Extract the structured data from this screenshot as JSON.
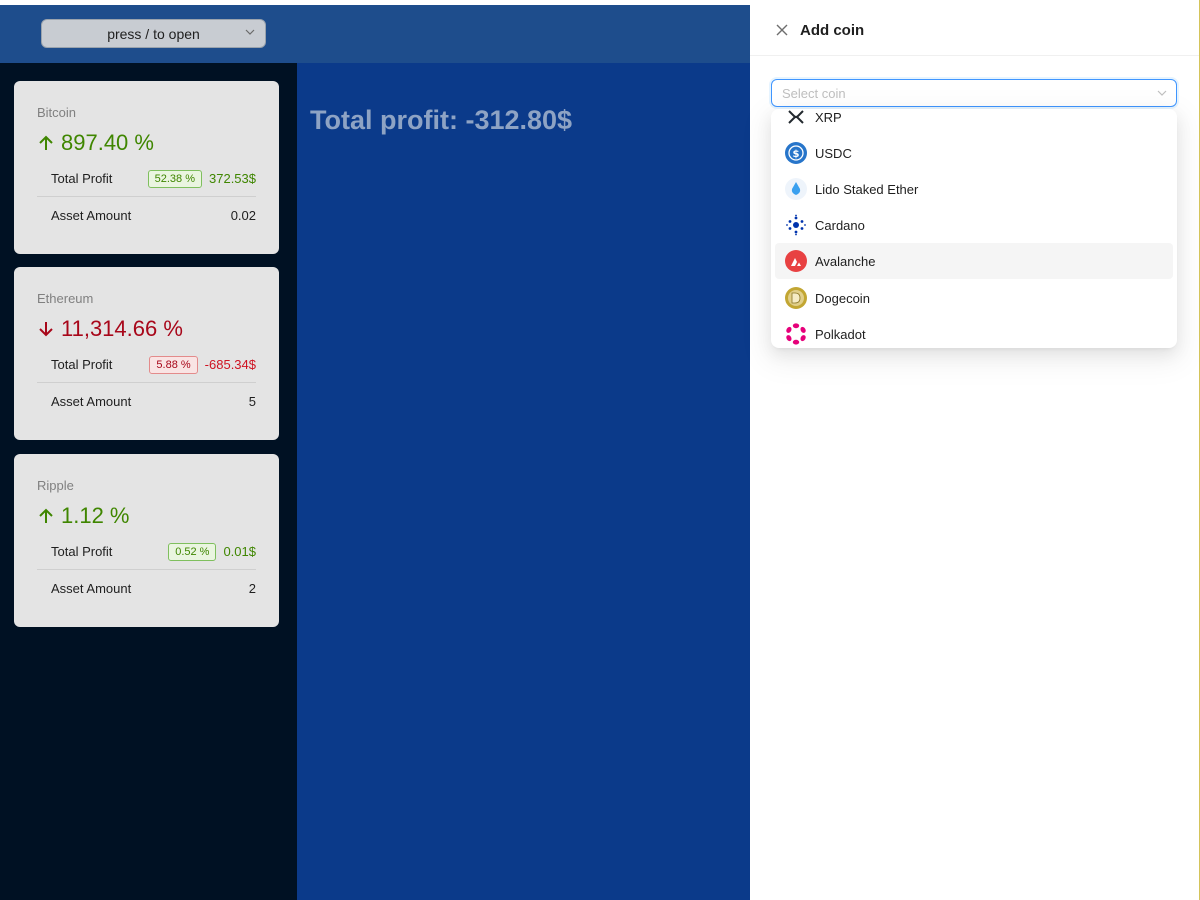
{
  "header": {
    "select_placeholder": "press / to open"
  },
  "cards": [
    {
      "name": "Bitcoin",
      "percent": "897.40 %",
      "direction": "up",
      "profit_label": "Total Profit",
      "profit_tag": "52.38 %",
      "profit_value": "372.53$",
      "amount_label": "Asset Amount",
      "amount_value": "0.02"
    },
    {
      "name": "Ethereum",
      "percent": "11,314.66 %",
      "direction": "down",
      "profit_label": "Total Profit",
      "profit_tag": "5.88 %",
      "profit_value": "-685.34$",
      "amount_label": "Asset Amount",
      "amount_value": "5"
    },
    {
      "name": "Ripple",
      "percent": "1.12 %",
      "direction": "up",
      "profit_label": "Total Profit",
      "profit_tag": "0.52 %",
      "profit_value": "0.01$",
      "amount_label": "Asset Amount",
      "amount_value": "2"
    }
  ],
  "main": {
    "total_profit": "Total profit: -312.80$"
  },
  "drawer": {
    "title": "Add coin",
    "select_placeholder": "Select coin",
    "options": [
      {
        "name": "XRP",
        "icon": "xrp-icon"
      },
      {
        "name": "USDC",
        "icon": "usdc-icon"
      },
      {
        "name": "Lido Staked Ether",
        "icon": "lido-icon"
      },
      {
        "name": "Cardano",
        "icon": "cardano-icon"
      },
      {
        "name": "Avalanche",
        "icon": "avalanche-icon",
        "highlighted": true
      },
      {
        "name": "Dogecoin",
        "icon": "dogecoin-icon"
      },
      {
        "name": "Polkadot",
        "icon": "polkadot-icon"
      }
    ]
  },
  "colors": {
    "header_bg": "#1e4d8c",
    "sidebar_bg": "#001123",
    "main_bg": "#0b3a8a",
    "up": "#3f8600",
    "down": "#cf1322",
    "accent": "#4096ff"
  }
}
